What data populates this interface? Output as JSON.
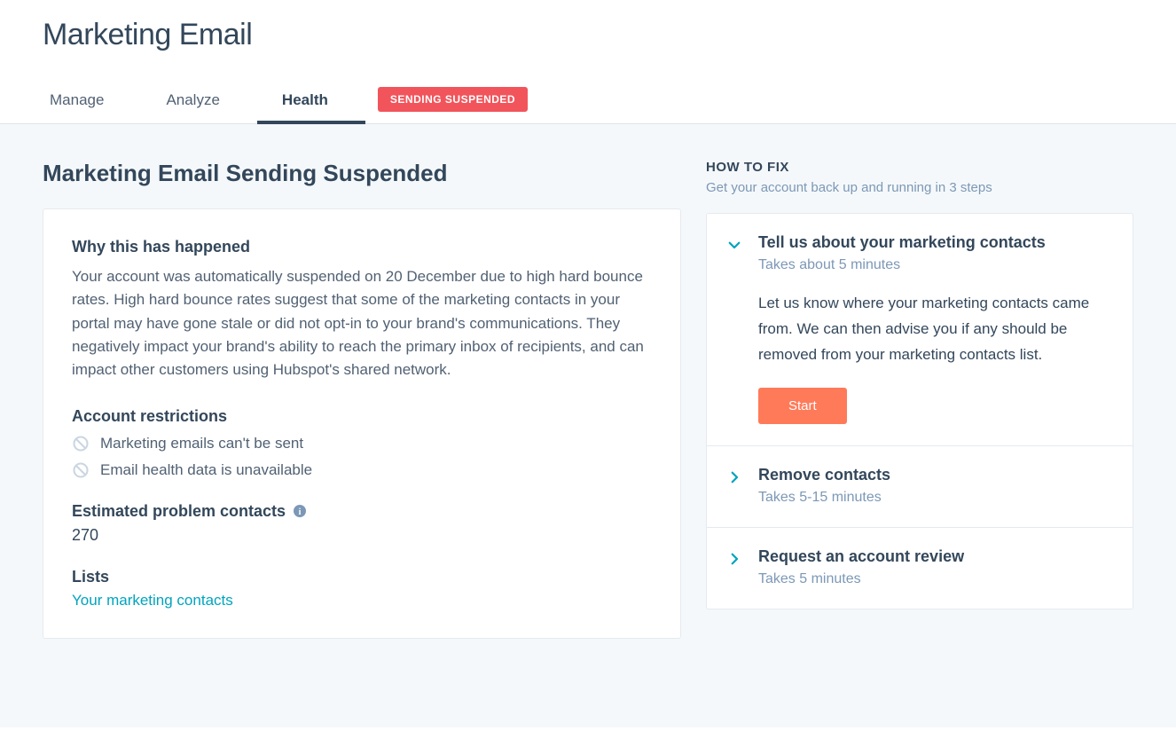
{
  "page": {
    "title": "Marketing Email"
  },
  "tabs": {
    "manage": "Manage",
    "analyze": "Analyze",
    "health": "Health"
  },
  "badge": "SENDING SUSPENDED",
  "suspended": {
    "heading": "Marketing Email Sending Suspended",
    "why_heading": "Why this has happened",
    "why_body": "Your account was automatically suspended on 20 December due to high hard bounce rates. High hard bounce rates suggest that some of the marketing contacts in your portal may have gone stale or did not opt-in to your brand's communications. They negatively impact your brand's ability to reach the primary inbox of recipients, and can impact other customers using Hubspot's shared network.",
    "restrictions_heading": "Account restrictions",
    "restrictions": [
      "Marketing emails can't be sent",
      "Email health data is unavailable"
    ],
    "estimated_label": "Estimated problem contacts",
    "estimated_value": "270",
    "lists_label": "Lists",
    "lists_link": "Your marketing contacts"
  },
  "howto": {
    "heading": "HOW TO FIX",
    "sub": "Get your account back up and running in 3 steps",
    "steps": [
      {
        "title": "Tell us about your marketing contacts",
        "duration": "Takes about 5 minutes",
        "desc": "Let us know where your marketing contacts came from. We can then advise you if any should be removed from your marketing contacts list.",
        "button": "Start"
      },
      {
        "title": "Remove contacts",
        "duration": "Takes 5-15 minutes"
      },
      {
        "title": "Request an account review",
        "duration": "Takes 5 minutes"
      }
    ]
  }
}
